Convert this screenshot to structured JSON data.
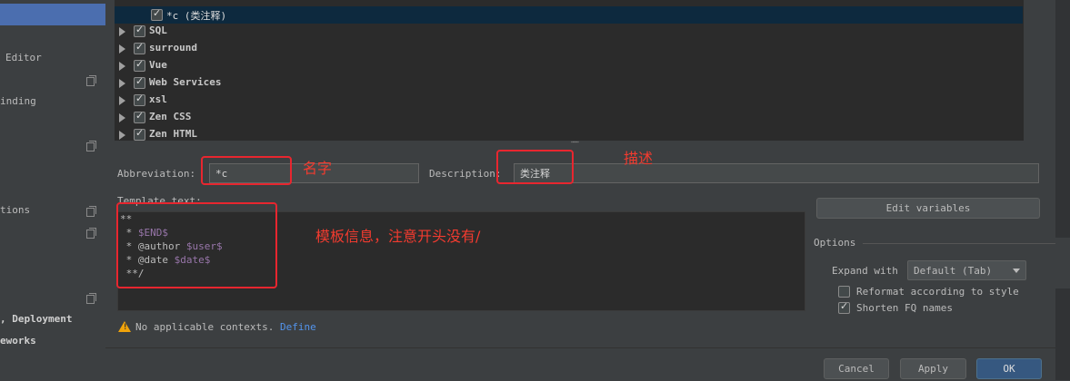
{
  "sidebar": {
    "items": [
      {
        "label": "Editor"
      },
      {
        "label": "inding"
      },
      {
        "label": "tions"
      },
      {
        "label": ", Deployment"
      },
      {
        "label": "eworks"
      }
    ]
  },
  "tree": {
    "selected_label": "*c (类注释)",
    "groups": [
      "SQL",
      "surround",
      "Vue",
      "Web Services",
      "xsl",
      "Zen CSS",
      "Zen HTML"
    ]
  },
  "form": {
    "abbreviation_label": "Abbreviation:",
    "abbreviation_value": "*c",
    "description_label": "Description:",
    "description_value": "类注释",
    "template_label": "Template text:",
    "template_lines": [
      {
        "pre": "**",
        "var": "",
        "post": ""
      },
      {
        "pre": " * ",
        "var": "$END$",
        "post": ""
      },
      {
        "pre": " * @author ",
        "var": "$user$",
        "post": ""
      },
      {
        "pre": " * @date ",
        "var": "$date$",
        "post": ""
      },
      {
        "pre": " **/",
        "var": "",
        "post": ""
      }
    ]
  },
  "options": {
    "edit_variables_label": "Edit variables",
    "title": "Options",
    "expand_with_label": "Expand with",
    "expand_with_value": "Default (Tab)",
    "reformat_label": "Reformat according to style",
    "reformat_checked": false,
    "shorten_fq_label": "Shorten FQ names",
    "shorten_fq_checked": true
  },
  "context": {
    "warning_text": "No applicable contexts.",
    "define_link": "Define"
  },
  "buttons": {
    "cancel": "Cancel",
    "apply": "Apply",
    "ok": "OK"
  },
  "annotations": {
    "name_note": "名字",
    "description_note": "描述",
    "template_note": "模板信息，注意开头没有/"
  },
  "colors": {
    "annotation": "#e8262f",
    "selection": "#4b6eaf",
    "primary_button": "#365880",
    "template_variable": "#9876aa",
    "link": "#5394ec",
    "warning": "#f0a30a"
  }
}
